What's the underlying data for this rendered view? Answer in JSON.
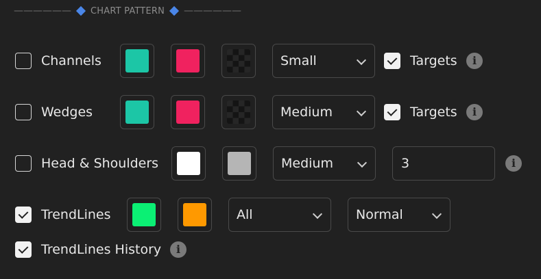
{
  "section": {
    "title": "CHART PATTERN",
    "dashes": "——————"
  },
  "rows": {
    "channels": {
      "label": "Channels",
      "checked": false,
      "colors": [
        "#1cc6a6",
        "#f0225f"
      ],
      "size": "Small",
      "targets": {
        "label": "Targets",
        "checked": true
      }
    },
    "wedges": {
      "label": "Wedges",
      "checked": false,
      "colors": [
        "#1cc6a6",
        "#f0225f"
      ],
      "size": "Medium",
      "targets": {
        "label": "Targets",
        "checked": true
      }
    },
    "head_shoulders": {
      "label": "Head & Shoulders",
      "checked": false,
      "colors": [
        "#ffffff",
        "#b5b5b5"
      ],
      "size": "Medium",
      "value": "3"
    },
    "trendlines": {
      "label": "TrendLines",
      "checked": true,
      "colors": [
        "#0bf074",
        "#ff9900"
      ],
      "mode": "All",
      "style": "Normal"
    },
    "trendlines_history": {
      "label": "TrendLines History",
      "checked": true
    }
  },
  "icons": {
    "info": "info-icon",
    "checkmark": "checkmark-icon",
    "chevron": "chevron-down-icon",
    "transparent": "transparent-swatch-icon"
  }
}
